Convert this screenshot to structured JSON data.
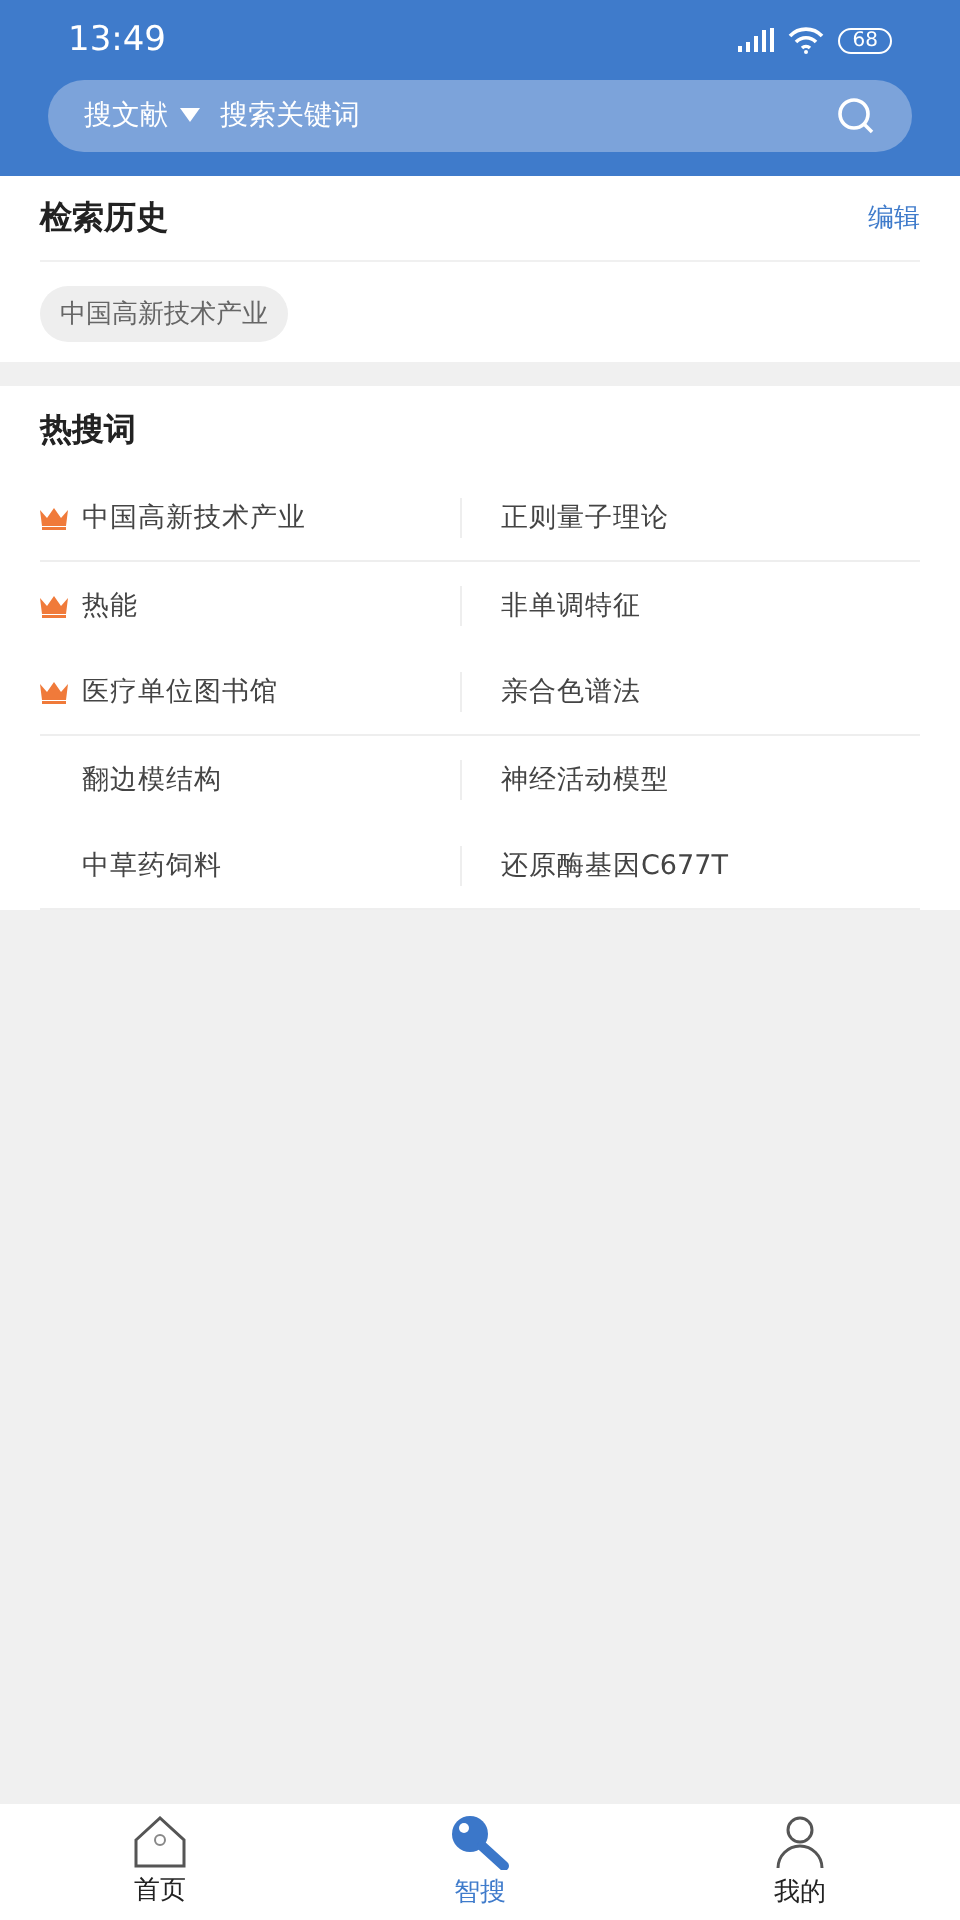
{
  "status_bar": {
    "time": "13:49",
    "battery": "68"
  },
  "search": {
    "scope": "搜文献",
    "placeholder": "搜索关键词"
  },
  "history": {
    "title": "检索历史",
    "edit": "编辑",
    "tags": [
      "中国高新技术产业"
    ]
  },
  "hot": {
    "title": "热搜词",
    "items": [
      {
        "text": "中国高新技术产业",
        "hot": true
      },
      {
        "text": "正则量子理论",
        "hot": false
      },
      {
        "text": "热能",
        "hot": true
      },
      {
        "text": "非单调特征",
        "hot": false
      },
      {
        "text": "医疗单位图书馆",
        "hot": true
      },
      {
        "text": "亲合色谱法",
        "hot": false
      },
      {
        "text": "翻边模结构",
        "hot": false
      },
      {
        "text": "神经活动模型",
        "hot": false
      },
      {
        "text": "中草药饲料",
        "hot": false
      },
      {
        "text": "还原酶基因C677T",
        "hot": false
      }
    ]
  },
  "tabs": [
    {
      "kind": "home",
      "label": "首页",
      "selected": false
    },
    {
      "kind": "search",
      "label": "智搜",
      "selected": true
    },
    {
      "kind": "profile",
      "label": "我的",
      "selected": false
    }
  ]
}
